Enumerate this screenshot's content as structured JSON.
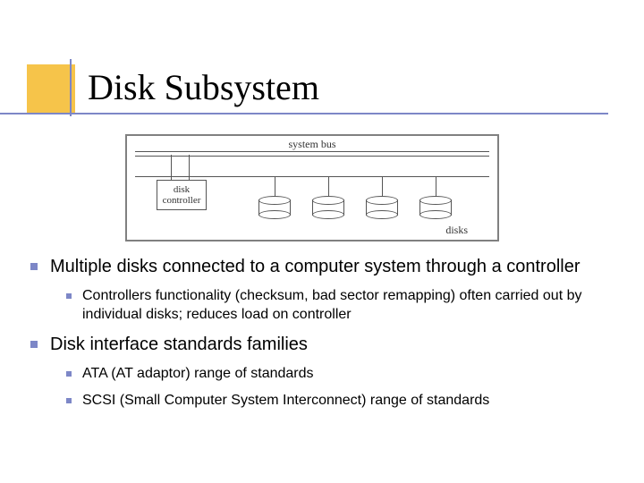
{
  "title": "Disk Subsystem",
  "diagram": {
    "sys_bus_label": "system bus",
    "controller_line1": "disk",
    "controller_line2": "controller",
    "disks_label": "disks"
  },
  "bullets": {
    "b1a": "Multiple disks connected to a computer system through a controller",
    "b1a_sub1": "Controllers functionality (checksum, bad sector remapping) often carried out by individual disks; reduces load on controller",
    "b1b": "Disk interface standards families",
    "b1b_sub1": "ATA (AT adaptor) range of standards",
    "b1b_sub2": "SCSI (Small Computer System Interconnect) range of standards"
  }
}
